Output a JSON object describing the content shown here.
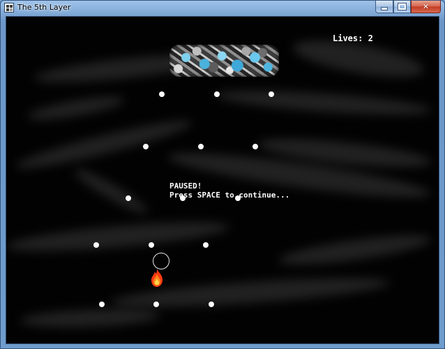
{
  "window": {
    "title": "The 5th Layer",
    "icon": "app-icon",
    "controls": [
      "minimize-icon",
      "maximize-icon",
      "close-icon"
    ]
  },
  "hud": {
    "lives_label": "Lives: 2"
  },
  "pause": {
    "line1": "PAUSED!",
    "line2": "Press SPACE to continue..."
  },
  "colors": {
    "background": "#020202",
    "bullet": "#ffffff",
    "boss_accent": "#5bc0e8",
    "player_flame": "#ff3b10"
  }
}
